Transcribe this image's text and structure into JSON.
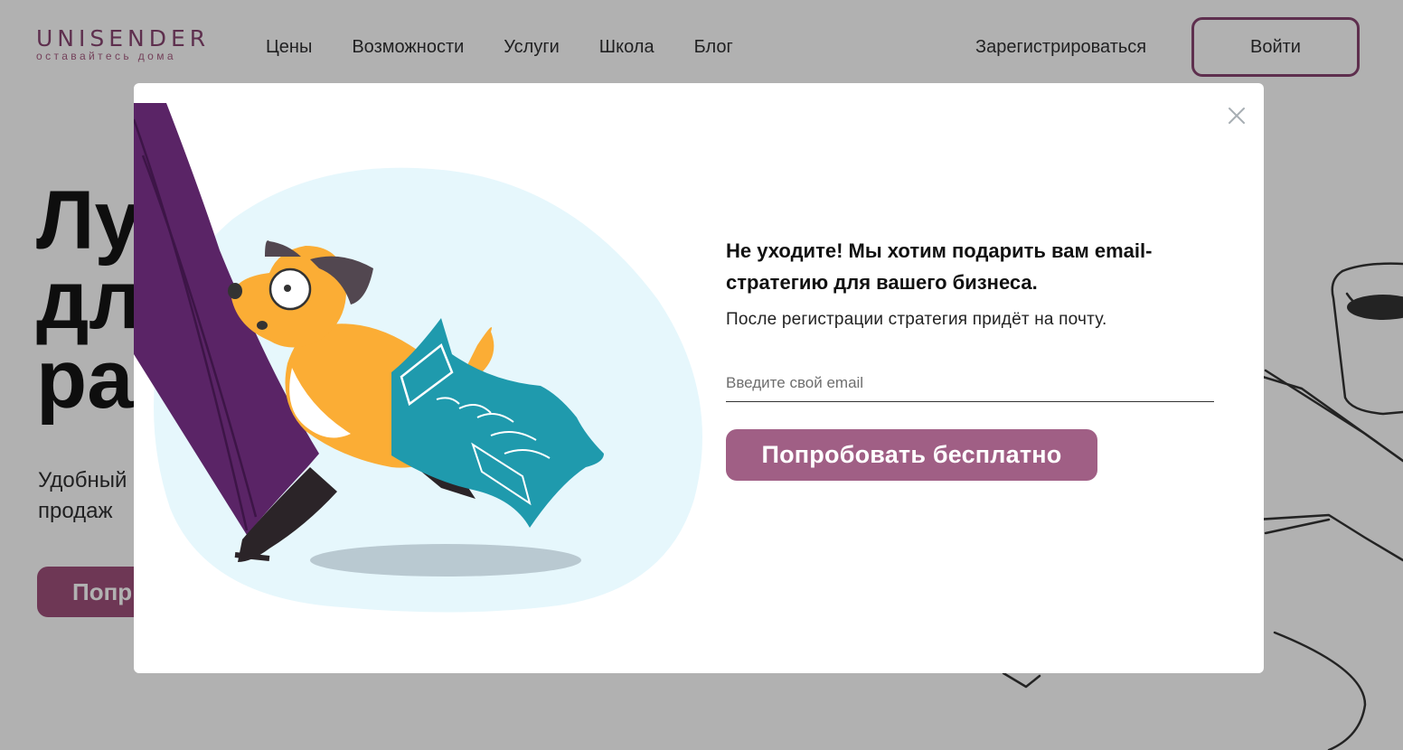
{
  "header": {
    "logo_main": "UNISENDER",
    "logo_sub": "оставайтесь дома",
    "nav": [
      "Цены",
      "Возможности",
      "Услуги",
      "Школа",
      "Блог"
    ],
    "register_label": "Зарегистрироваться",
    "login_label": "Войти"
  },
  "hero": {
    "title_lines": [
      "Лу",
      "дл",
      "ра"
    ],
    "subtitle_lines": [
      "Удобный",
      "продаж"
    ],
    "button_label": "Попр"
  },
  "modal": {
    "title": "Не уходите! Мы хотим подарить вам email-стратегию для вашего бизнеса.",
    "description": "После регистрации стратегия придёт на почту.",
    "email_placeholder": "Введите свой email",
    "cta_label": "Попробовать бесплатно"
  },
  "icons": {
    "close": "close-icon"
  },
  "colors": {
    "brand": "#7d3565",
    "cta": "#a05f85",
    "overlay": "rgba(40,40,40,0.36)",
    "illustration_bg": "#e6f7fc",
    "dog": "#fbad35",
    "leg": "#5a2466",
    "paper": "#1f9aad"
  }
}
